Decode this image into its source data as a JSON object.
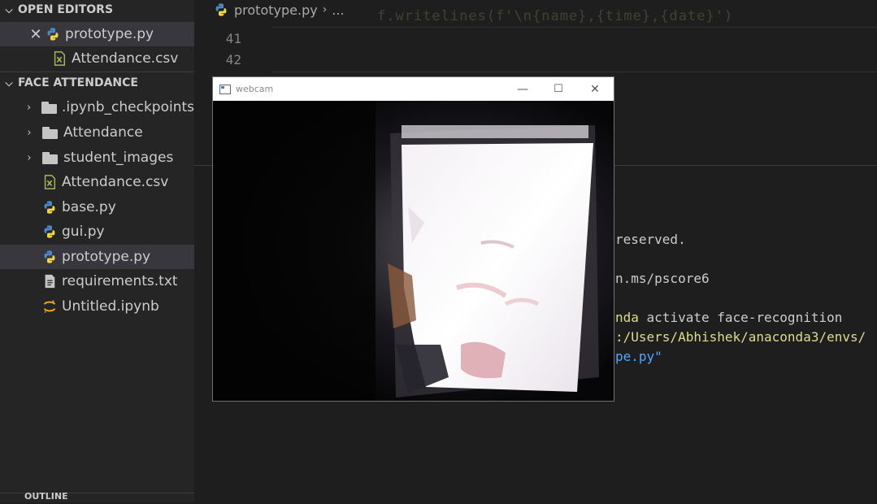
{
  "sidebar": {
    "open_editors": {
      "title": "OPEN EDITORS",
      "items": [
        {
          "label": "prototype.py",
          "icon": "python-icon"
        },
        {
          "label": "Attendance.csv",
          "icon": "csv-icon"
        }
      ]
    },
    "workspace": {
      "title": "FACE ATTENDANCE",
      "items": [
        {
          "label": ".ipynb_checkpoints",
          "icon": "folder-icon"
        },
        {
          "label": "Attendance",
          "icon": "folder-icon"
        },
        {
          "label": "student_images",
          "icon": "folder-icon"
        },
        {
          "label": "Attendance.csv",
          "icon": "csv-icon"
        },
        {
          "label": "base.py",
          "icon": "python-icon"
        },
        {
          "label": "gui.py",
          "icon": "python-icon"
        },
        {
          "label": "prototype.py",
          "icon": "python-icon"
        },
        {
          "label": "requirements.txt",
          "icon": "text-file-icon"
        },
        {
          "label": "Untitled.ipynb",
          "icon": "jupyter-icon"
        }
      ]
    },
    "outline_title": "OUTLINE"
  },
  "editor": {
    "breadcrumb": {
      "file": "prototype.py",
      "more": "..."
    },
    "ghost_code": "f.writelines(f'\\n{name},{time},{date}')",
    "line_numbers": [
      "41",
      "42"
    ]
  },
  "terminal": {
    "lines": [
      {
        "text": "reserved."
      },
      {
        "text": "n.ms/pscore6"
      },
      {
        "prefix": "nda",
        "rest": " activate face-recognition"
      },
      {
        "text": ":/Users/Abhishek/anaconda3/envs/"
      },
      {
        "text": "pe.py\""
      }
    ]
  },
  "webcam_window": {
    "title": "webcam",
    "minimize": "—",
    "maximize": "☐",
    "close": "✕"
  },
  "colors": {
    "sidebar_bg": "#252526",
    "editor_bg": "#1e1e1e",
    "selected_row": "#37373d",
    "python_blue": "#4a8bc7",
    "python_yellow": "#f5d442",
    "csv_green": "#a2b85a",
    "terminal_yellow": "#dcdc8b",
    "terminal_blue": "#4fa7ff"
  }
}
